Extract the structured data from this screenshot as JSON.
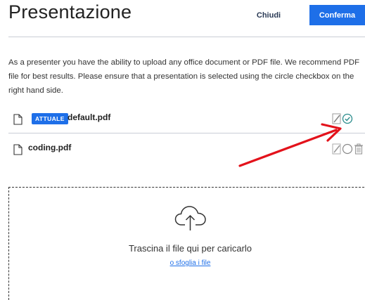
{
  "header": {
    "title": "Presentazione",
    "close_label": "Chiudi",
    "confirm_label": "Conferma"
  },
  "description": {
    "lines": [
      "As a presenter you have the ability to upload any office document or PDF file. We recommend PDF",
      "file for best results. Please ensure that a presentation is selected using the circle checkbox on the",
      "right hand side."
    ]
  },
  "files": [
    {
      "badge": "ATTUALE",
      "name": "default.pdf",
      "selected": true,
      "actions": [
        "edit-icon",
        "check-circle-icon"
      ]
    },
    {
      "badge": "",
      "name": "coding.pdf",
      "selected": false,
      "actions": [
        "edit-icon",
        "circle-icon",
        "trash-icon"
      ]
    }
  ],
  "dropzone": {
    "icon": "cloud-upload-icon",
    "text": "Trascina il file qui per caricarlo",
    "link": "o sfoglia i file"
  },
  "colors": {
    "accent": "#1e6fe8",
    "annotation_arrow": "#e3121b"
  }
}
